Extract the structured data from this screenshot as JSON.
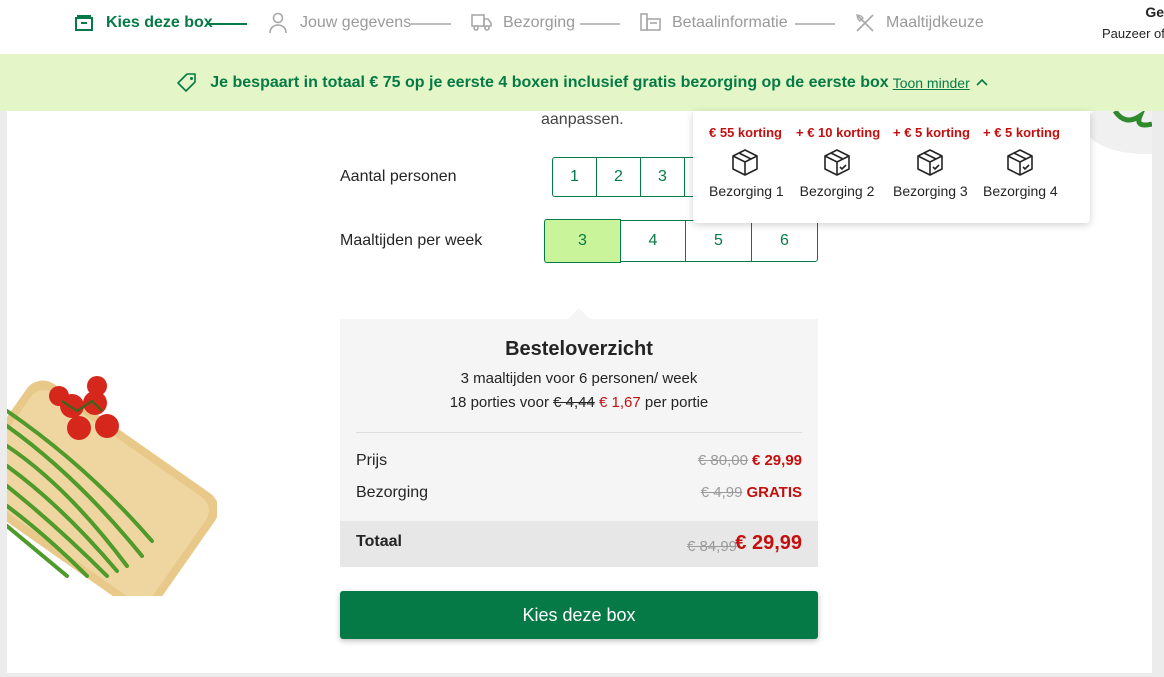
{
  "steps": [
    {
      "label": "Kies deze box",
      "icon": "box-icon",
      "active": true
    },
    {
      "label": "Jouw gegevens",
      "icon": "person-icon",
      "active": false
    },
    {
      "label": "Bezorging",
      "icon": "truck-icon",
      "active": false
    },
    {
      "label": "Betaalinformatie",
      "icon": "card-icon",
      "active": false
    },
    {
      "label": "Maaltijdkeuze",
      "icon": "cutlery-icon",
      "active": false
    }
  ],
  "header_right": {
    "line1": "Ge",
    "line2": "Pauzeer of"
  },
  "banner": {
    "text": "Je bespaart in totaal € 75 op je eerste 4 boxen inclusief gratis bezorging op de eerste box",
    "toggle": "Toon minder"
  },
  "aanpassen": "aanpassen.",
  "personen": {
    "label": "Aantal personen",
    "options": [
      "1",
      "2",
      "3"
    ]
  },
  "maaltijden": {
    "label": "Maaltijden per week",
    "options": [
      "3",
      "4",
      "5",
      "6"
    ],
    "selected": "3"
  },
  "popup": [
    {
      "korting": "€ 55 korting",
      "label": "Bezorging 1"
    },
    {
      "korting": "+ € 10 korting",
      "label": "Bezorging 2"
    },
    {
      "korting": "+ € 5 korting",
      "label": "Bezorging 3"
    },
    {
      "korting": "+ € 5 korting",
      "label": "Bezorging 4"
    }
  ],
  "summary": {
    "title": "Besteloverzicht",
    "line1": "3 maaltijden voor 6 personen/ week",
    "line2_prefix": "18 porties voor",
    "line2_old": "€ 4,44",
    "line2_new": "€ 1,67",
    "line2_suffix": "per portie",
    "rows": [
      {
        "label": "Prijs",
        "old": "€ 80,00",
        "new": "€ 29,99"
      },
      {
        "label": "Bezorging",
        "old": "€ 4,99",
        "new": "GRATIS"
      }
    ],
    "total": {
      "label": "Totaal",
      "old": "€ 84,99",
      "new": "€ 29,99"
    }
  },
  "cta": "Kies deze box",
  "colors": {
    "brand_green": "#067a46",
    "banner_bg": "#e4f6c7",
    "selected_bg": "#c9f49a",
    "discount_red": "#c40f0f"
  }
}
